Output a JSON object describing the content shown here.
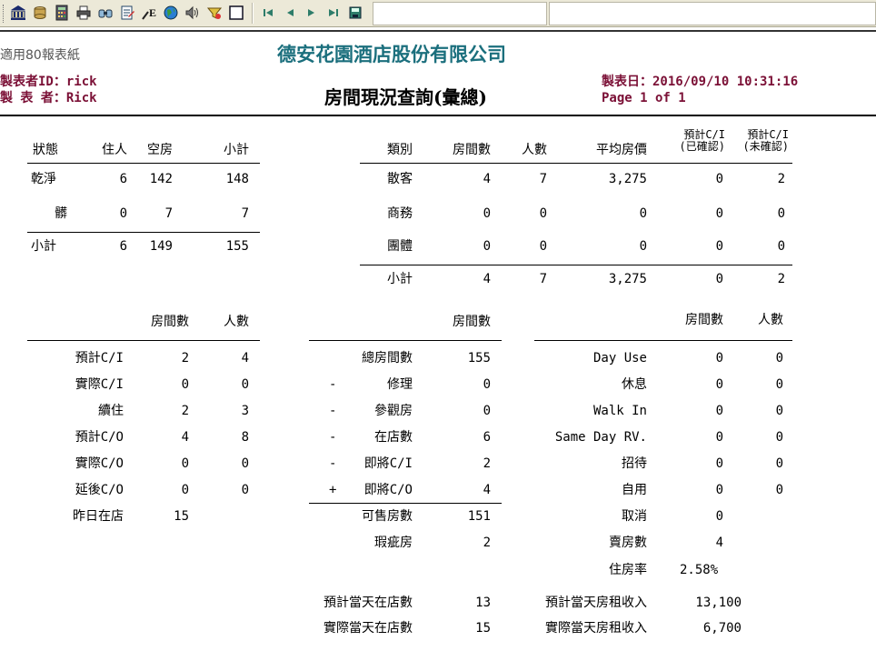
{
  "toolbar": {
    "buttons": [
      "bank-icon",
      "database-icon",
      "calculator-icon",
      "printer-icon",
      "binoculars-icon",
      "edit-document-icon",
      "pen-e-icon",
      "globe-icon",
      "speaker-icon",
      "filter-icon",
      "blank-page-icon",
      "first-page-icon",
      "previous-page-icon",
      "next-page-icon",
      "last-page-icon",
      "save-disk-icon"
    ]
  },
  "header": {
    "paper_note": "適用80報表紙",
    "company": "德安花園酒店股份有限公司",
    "creator_id_label": "製表者ID：",
    "creator_id": "rick",
    "creator_label": "製 表 者：",
    "creator": "Rick",
    "title": "房間現況查詢(彙總)",
    "date_label": "製表日：",
    "date": "2016/09/10 10:31:16",
    "page_text": "Page 1 of 1"
  },
  "status_table": {
    "headers": [
      "狀態",
      "住人",
      "空房",
      "小計"
    ],
    "rows": [
      [
        "乾淨",
        "6",
        "142",
        "148"
      ],
      [
        "髒",
        "0",
        "7",
        "7"
      ]
    ],
    "total": [
      "小計",
      "6",
      "149",
      "155"
    ]
  },
  "category_table": {
    "headers": [
      "類別",
      "房間數",
      "人數",
      "平均房價"
    ],
    "header_ci_confirmed": [
      "預計C/I",
      "(已確認)"
    ],
    "header_ci_unconfirmed": [
      "預計C/I",
      "(未確認)"
    ],
    "rows": [
      [
        "散客",
        "4",
        "7",
        "3,275",
        "0",
        "2"
      ],
      [
        "商務",
        "0",
        "0",
        "0",
        "0",
        "0"
      ],
      [
        "團體",
        "0",
        "0",
        "0",
        "0",
        "0"
      ]
    ],
    "total": [
      "小計",
      "4",
      "7",
      "3,275",
      "0",
      "2"
    ]
  },
  "movement_table": {
    "headers": [
      "房間數",
      "人數"
    ],
    "rows": [
      [
        "預計C/I",
        "2",
        "4"
      ],
      [
        "實際C/I",
        "0",
        "0"
      ],
      [
        "續住",
        "2",
        "3"
      ],
      [
        "預計C/O",
        "4",
        "8"
      ],
      [
        "實際C/O",
        "0",
        "0"
      ],
      [
        "延後C/O",
        "0",
        "0"
      ],
      [
        "昨日在店",
        "15",
        ""
      ]
    ]
  },
  "availability_table": {
    "header": "房間數",
    "rows": [
      [
        "",
        "總房間數",
        "155"
      ],
      [
        "-",
        "修理",
        "0"
      ],
      [
        "-",
        "參觀房",
        "0"
      ],
      [
        "-",
        "在店數",
        "6"
      ],
      [
        "-",
        "即將C/I",
        "2"
      ],
      [
        "+",
        "即將C/O",
        "4"
      ]
    ],
    "sellable": [
      "可售房數",
      "151"
    ],
    "defect": [
      "瑕疵房",
      "2"
    ]
  },
  "usage_table": {
    "headers": [
      "房間數",
      "人數"
    ],
    "rows": [
      [
        "Day Use",
        "0",
        "0"
      ],
      [
        "休息",
        "0",
        "0"
      ],
      [
        "Walk In",
        "0",
        "0"
      ],
      [
        "Same Day RV.",
        "0",
        "0"
      ],
      [
        "招待",
        "0",
        "0"
      ],
      [
        "自用",
        "0",
        "0"
      ],
      [
        "取消",
        "0",
        ""
      ],
      [
        "賣房數",
        "4",
        ""
      ],
      [
        "住房率",
        "2.58%",
        ""
      ]
    ]
  },
  "summary": {
    "expected_in_house_label": "預計當天在店數",
    "expected_in_house": "13",
    "actual_in_house_label": "實際當天在店數",
    "actual_in_house": "15",
    "expected_revenue_label": "預計當天房租收入",
    "expected_revenue": "13,100",
    "actual_revenue_label": "實際當天房租收入",
    "actual_revenue": "6,700"
  }
}
